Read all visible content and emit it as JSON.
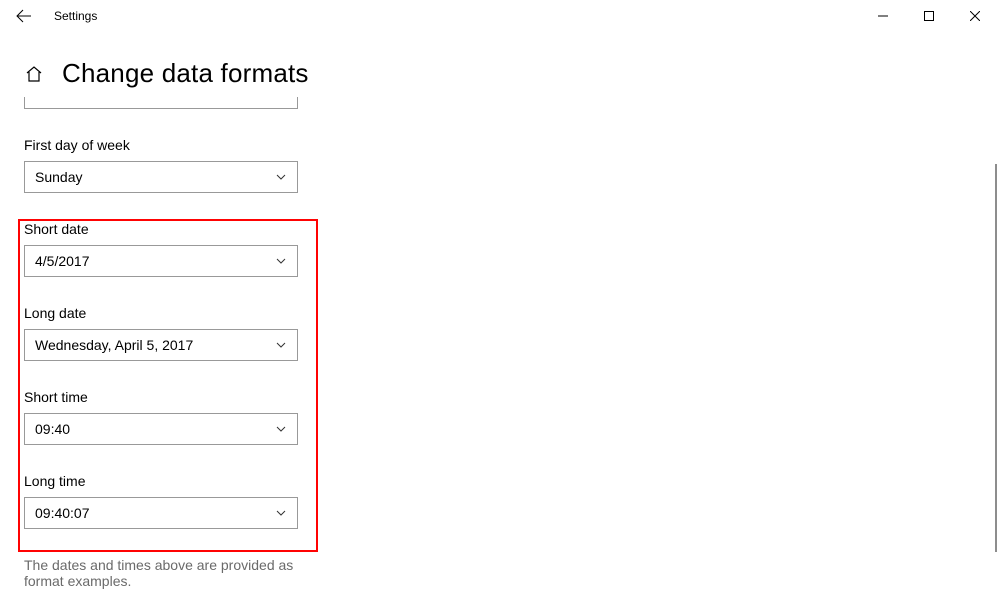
{
  "app": {
    "title": "Settings"
  },
  "page": {
    "title": "Change data formats"
  },
  "fields": {
    "first_day": {
      "label": "First day of week",
      "value": "Sunday"
    },
    "short_date": {
      "label": "Short date",
      "value": "4/5/2017"
    },
    "long_date": {
      "label": "Long date",
      "value": "Wednesday, April 5, 2017"
    },
    "short_time": {
      "label": "Short time",
      "value": "09:40"
    },
    "long_time": {
      "label": "Long time",
      "value": "09:40:07"
    }
  },
  "footnote": "The dates and times above are provided as format examples."
}
